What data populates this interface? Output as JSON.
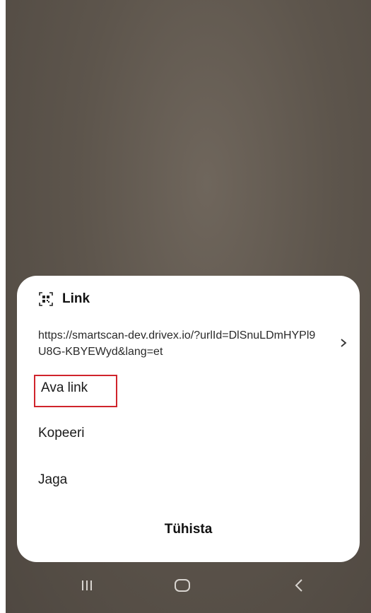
{
  "dialog": {
    "title": "Link",
    "url_text": "https://smartscan-dev.drivex.io/?urlId=DlSnuLDmHYPl9U8G-KBYEWyd&lang=et",
    "actions": {
      "open_label": "Ava link",
      "copy_label": "Kopeeri",
      "share_label": "Jaga"
    },
    "cancel_label": "Tühista"
  },
  "icons": {
    "header": "qr-code-icon",
    "url_row": "chevron-right-icon",
    "nav_recent": "recent-apps-icon",
    "nav_home": "home-icon",
    "nav_back": "back-icon"
  },
  "colors": {
    "highlight_border": "#d0242c",
    "background": "#5d554c",
    "sheet": "#ffffff"
  }
}
